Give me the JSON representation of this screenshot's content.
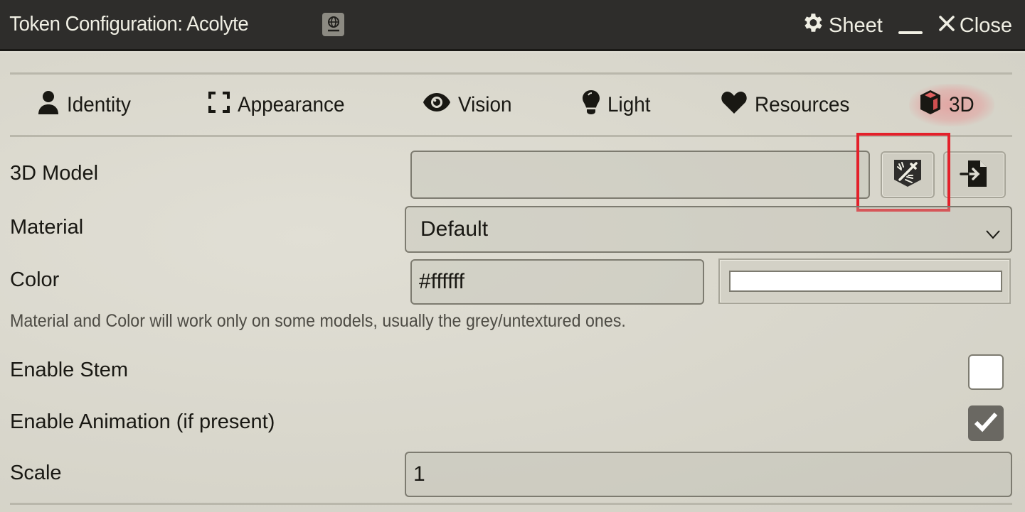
{
  "window": {
    "title": "Token Configuration: Acolyte",
    "controls": [
      {
        "icon": "gear-icon",
        "label": "Sheet"
      },
      {
        "icon": "minimize-icon",
        "label": ""
      },
      {
        "icon": "close-icon",
        "label": "Close"
      }
    ]
  },
  "tabs": [
    {
      "icon": "user-icon",
      "label": "Identity",
      "active": false
    },
    {
      "icon": "expand-icon",
      "label": "Appearance",
      "active": false
    },
    {
      "icon": "eye-icon",
      "label": "Vision",
      "active": false
    },
    {
      "icon": "lightbulb-icon",
      "label": "Light",
      "active": false
    },
    {
      "icon": "heart-icon",
      "label": "Resources",
      "active": false
    },
    {
      "icon": "cube-icon",
      "label": "3D",
      "active": true
    }
  ],
  "form": {
    "model": {
      "label": "3D Model",
      "value": "",
      "buttons": [
        "asset-browser-button",
        "file-picker-button"
      ]
    },
    "material": {
      "label": "Material",
      "selected": "Default"
    },
    "color": {
      "label": "Color",
      "value": "#ffffff",
      "swatch": "#ffffff"
    },
    "hint": "Material and Color will work only on some models, usually the grey/untextured ones.",
    "enable_stem": {
      "label": "Enable Stem",
      "checked": false
    },
    "enable_animation": {
      "label": "Enable Animation (if present)",
      "checked": true
    },
    "scale": {
      "label": "Scale",
      "value": "1"
    }
  },
  "colors": {
    "header_bg": "#2e2d2b",
    "accent_highlight": "#e3202a",
    "active_tab_glow": "#e69696"
  }
}
